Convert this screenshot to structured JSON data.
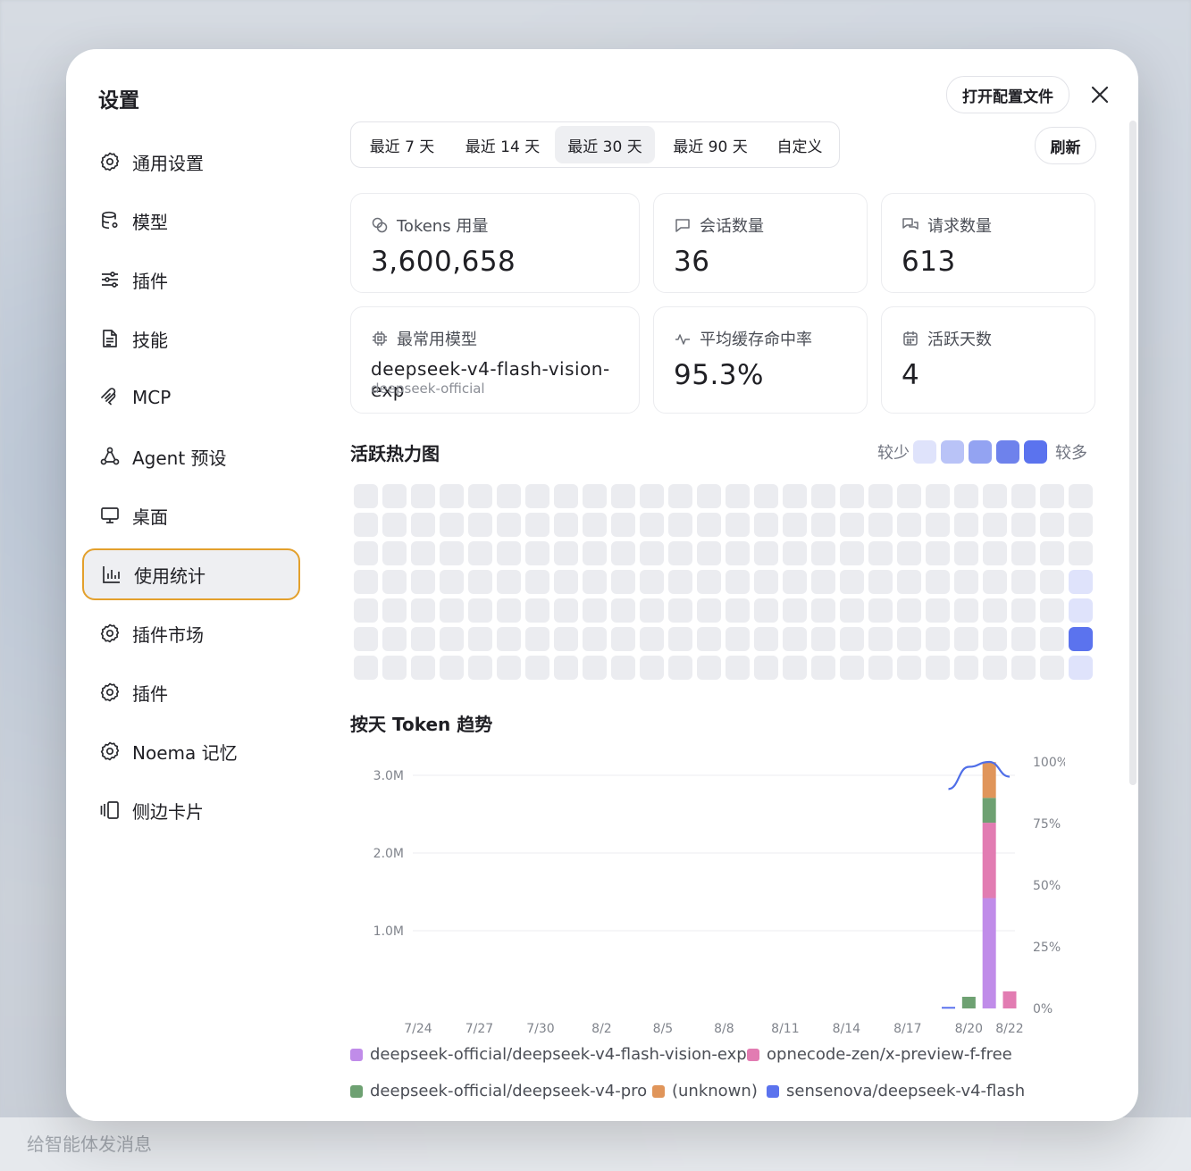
{
  "background": {
    "composer_placeholder": "给智能体发消息"
  },
  "modal": {
    "title": "设置",
    "open_config_label": "打开配置文件",
    "refresh_label": "刷新"
  },
  "sidebar": {
    "items": [
      {
        "label": "通用设置",
        "icon": "gear-icon"
      },
      {
        "label": "模型",
        "icon": "database-icon"
      },
      {
        "label": "插件",
        "icon": "sliders-icon"
      },
      {
        "label": "技能",
        "icon": "document-icon"
      },
      {
        "label": "MCP",
        "icon": "mcp-icon"
      },
      {
        "label": "Agent 预设",
        "icon": "nodes-icon"
      },
      {
        "label": "桌面",
        "icon": "monitor-icon"
      },
      {
        "label": "使用统计",
        "icon": "bar-chart-icon",
        "active": true
      },
      {
        "label": "插件市场",
        "icon": "gear-icon"
      },
      {
        "label": "插件",
        "icon": "gear-icon"
      },
      {
        "label": "Noema 记忆",
        "icon": "gear-icon"
      },
      {
        "label": "侧边卡片",
        "icon": "cards-icon"
      }
    ]
  },
  "range_tabs": [
    "最近 7 天",
    "最近 14 天",
    "最近 30 天",
    "最近 90 天",
    "自定义"
  ],
  "range_selected": "最近 30 天",
  "stats": {
    "tokens": {
      "label": "Tokens 用量",
      "value": "3,600,658"
    },
    "sessions": {
      "label": "会话数量",
      "value": "36"
    },
    "requests": {
      "label": "请求数量",
      "value": "613"
    },
    "top_model": {
      "label": "最常用模型",
      "value": "deepseek-v4-flash-vision-exp",
      "provider": "deepseek-official"
    },
    "cache_hit": {
      "label": "平均缓存命中率",
      "value": "95.3%"
    },
    "active_days": {
      "label": "活跃天数",
      "value": "4"
    }
  },
  "heatmap": {
    "title": "活跃热力图",
    "less_label": "较少",
    "more_label": "较多",
    "scale_colors": [
      "#dfe3fb",
      "#b9c3f7",
      "#93a3f2",
      "#6e82ec",
      "#5b73ee"
    ],
    "empty_color": "#ebecf0",
    "rows": 7,
    "cols": 26,
    "active_cells": [
      {
        "row": 3,
        "col": 25,
        "level": 0
      },
      {
        "row": 4,
        "col": 25,
        "level": 0
      },
      {
        "row": 5,
        "col": 25,
        "level": 4
      },
      {
        "row": 6,
        "col": 25,
        "level": 0
      }
    ]
  },
  "trend": {
    "title": "按天 Token 趋势"
  },
  "chart_data": {
    "type": "bar",
    "stacked": true,
    "x": [
      "7/24",
      "7/25",
      "7/26",
      "7/27",
      "7/28",
      "7/29",
      "7/30",
      "7/31",
      "8/1",
      "8/2",
      "8/3",
      "8/4",
      "8/5",
      "8/6",
      "8/7",
      "8/8",
      "8/9",
      "8/10",
      "8/11",
      "8/12",
      "8/13",
      "8/14",
      "8/15",
      "8/16",
      "8/17",
      "8/18",
      "8/19",
      "8/20",
      "8/21",
      "8/22"
    ],
    "x_tick_labels": [
      "7/24",
      "7/27",
      "7/30",
      "8/2",
      "8/5",
      "8/8",
      "8/11",
      "8/14",
      "8/17",
      "8/20",
      "8/22"
    ],
    "ylim": [
      0,
      3000000
    ],
    "y_tick_labels": [
      "1.0M",
      "2.0M",
      "3.0M"
    ],
    "y_ticks": [
      1000000,
      2000000,
      3000000
    ],
    "y2lim": [
      0,
      100
    ],
    "y2_tick_labels": [
      "0%",
      "25%",
      "50%",
      "75%",
      "100%"
    ],
    "y2_ticks": [
      0,
      25,
      50,
      75,
      100
    ],
    "series": [
      {
        "name": "deepseek-official/deepseek-v4-flash-vision-exp",
        "color": "#c08ce9",
        "values": [
          0,
          0,
          0,
          0,
          0,
          0,
          0,
          0,
          0,
          0,
          0,
          0,
          0,
          0,
          0,
          0,
          0,
          0,
          0,
          0,
          0,
          0,
          0,
          0,
          0,
          0,
          0,
          0,
          1420000,
          0
        ]
      },
      {
        "name": "opnecode-zen/x-preview-f-free",
        "color": "#e27cb2",
        "values": [
          0,
          0,
          0,
          0,
          0,
          0,
          0,
          0,
          0,
          0,
          0,
          0,
          0,
          0,
          0,
          0,
          0,
          0,
          0,
          0,
          0,
          0,
          0,
          0,
          0,
          0,
          0,
          0,
          970000,
          220000
        ]
      },
      {
        "name": "deepseek-official/deepseek-v4-pro",
        "color": "#6ea172",
        "values": [
          0,
          0,
          0,
          0,
          0,
          0,
          0,
          0,
          0,
          0,
          0,
          0,
          0,
          0,
          0,
          0,
          0,
          0,
          0,
          0,
          0,
          0,
          0,
          0,
          0,
          0,
          0,
          150000,
          320000,
          0
        ]
      },
      {
        "name": "(unknown)",
        "color": "#e0955a",
        "values": [
          0,
          0,
          0,
          0,
          0,
          0,
          0,
          0,
          0,
          0,
          0,
          0,
          0,
          0,
          0,
          0,
          0,
          0,
          0,
          0,
          0,
          0,
          0,
          0,
          0,
          0,
          0,
          0,
          460000,
          0
        ]
      },
      {
        "name": "sensenova/deepseek-v4-flash",
        "color": "#5b73ee",
        "values": [
          0,
          0,
          0,
          0,
          0,
          0,
          0,
          0,
          0,
          0,
          0,
          0,
          0,
          0,
          0,
          0,
          0,
          0,
          0,
          0,
          0,
          0,
          0,
          0,
          0,
          0,
          20000,
          0,
          0,
          0
        ]
      }
    ],
    "line": {
      "name": "cache-hit-rate",
      "color": "#4f6ee8",
      "axis": "y2",
      "points": [
        {
          "x": "8/19",
          "y": 89
        },
        {
          "x": "8/20",
          "y": 98
        },
        {
          "x": "8/21",
          "y": 100
        },
        {
          "x": "8/22",
          "y": 94
        }
      ]
    }
  }
}
